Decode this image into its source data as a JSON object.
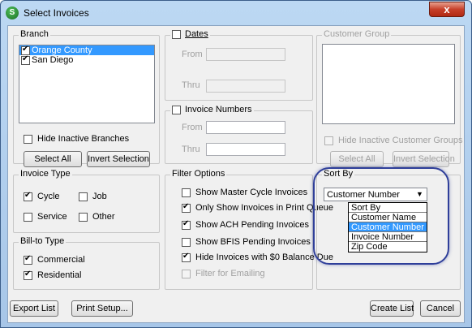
{
  "window": {
    "title": "Select Invoices",
    "app_icon_glyph": "S",
    "close_glyph": "x"
  },
  "branch": {
    "legend": "Branch",
    "items": [
      {
        "label": "Orange County",
        "checked": true,
        "selected": true
      },
      {
        "label": "San Diego",
        "checked": true,
        "selected": false
      }
    ],
    "hide_inactive": "Hide Inactive Branches",
    "select_all": "Select All",
    "invert_selection": "Invert Selection"
  },
  "dates": {
    "legend": "Dates",
    "from_label": "From",
    "thru_label": "Thru",
    "from_value": "",
    "thru_value": ""
  },
  "invoice_numbers": {
    "legend": "Invoice Numbers",
    "from_label": "From",
    "thru_label": "Thru",
    "from_value": "",
    "thru_value": ""
  },
  "customer_group": {
    "legend": "Customer Group",
    "hide_inactive": "Hide Inactive Customer Groups",
    "select_all": "Select All",
    "invert_selection": "Invert Selection"
  },
  "invoice_type": {
    "legend": "Invoice Type",
    "cycle": "Cycle",
    "job": "Job",
    "service": "Service",
    "other": "Other"
  },
  "bill_to_type": {
    "legend": "Bill-to Type",
    "commercial": "Commercial",
    "residential": "Residential"
  },
  "filter_options": {
    "legend": "Filter Options",
    "items": [
      {
        "label": "Show Master Cycle Invoices",
        "checked": false,
        "disabled": false
      },
      {
        "label": "Only Show Invoices in Print Queue",
        "checked": true,
        "disabled": false
      },
      {
        "label": "Show ACH Pending Invoices",
        "checked": true,
        "disabled": false
      },
      {
        "label": "Show BFIS Pending Invoices",
        "checked": false,
        "disabled": false
      },
      {
        "label": "Hide Invoices with $0 Balance Due",
        "checked": true,
        "disabled": false
      },
      {
        "label": "Filter for Emailing",
        "checked": false,
        "disabled": true
      }
    ]
  },
  "sort_by": {
    "legend": "Sort By",
    "selected_value": "Customer Number",
    "arrow_glyph": "▼",
    "options": [
      {
        "label": "Sort By",
        "selected": false
      },
      {
        "label": "Customer Name",
        "selected": false
      },
      {
        "label": "Customer Number",
        "selected": true
      },
      {
        "label": "Invoice Number",
        "selected": false
      },
      {
        "label": "Zip Code",
        "selected": false
      }
    ]
  },
  "footer": {
    "export_list": "Export List",
    "print_setup": "Print Setup...",
    "create_list": "Create List",
    "cancel": "Cancel"
  },
  "colors": {
    "selection": "#3399ff",
    "highlight_ring": "#2f3f9a",
    "close_button": "#c7402a"
  }
}
